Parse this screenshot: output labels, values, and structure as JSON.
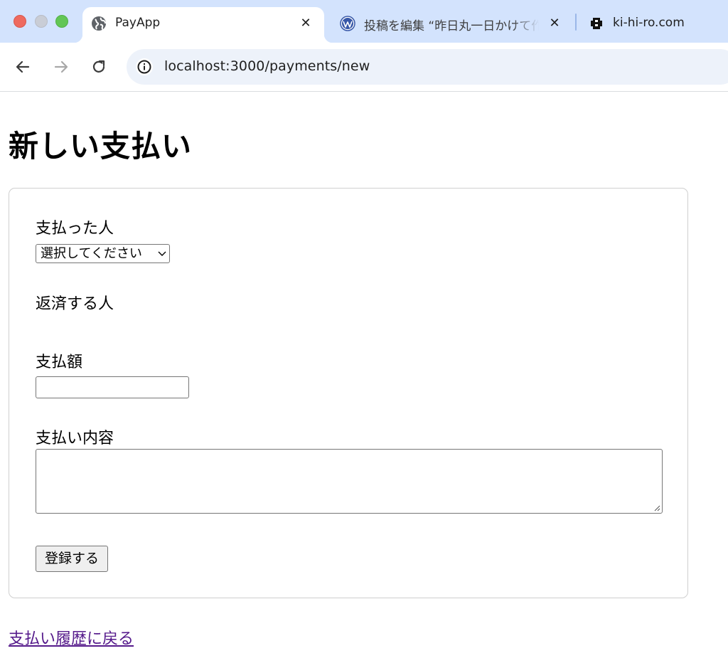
{
  "browser": {
    "tabs": [
      {
        "title": "PayApp",
        "favicon": "globe-icon",
        "active": true
      },
      {
        "title": "投稿を編集 “昨日丸一日かけて作ったアプリ",
        "favicon": "wordpress-icon",
        "active": false
      },
      {
        "title": "ki-hi-ro.com",
        "favicon": "site-logo-icon",
        "active": false
      }
    ],
    "close_glyph": "✕",
    "url": "localhost:3000/payments/new"
  },
  "page": {
    "title": "新しい支払い",
    "form": {
      "payer_label": "支払った人",
      "payer_select_value": "選択してください",
      "repayer_label": "返済する人",
      "amount_label": "支払額",
      "amount_value": "",
      "description_label": "支払い内容",
      "description_value": "",
      "submit_label": "登録する"
    },
    "back_link": "支払い履歴に戻る"
  },
  "colors": {
    "tabstrip": "#d3e3fd",
    "omnibox": "#edf2fa",
    "visited_link": "#551a8b"
  }
}
